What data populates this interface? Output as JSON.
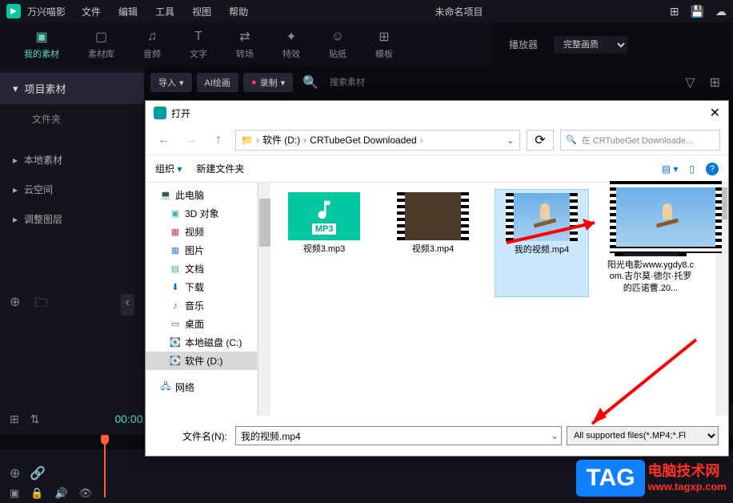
{
  "titlebar": {
    "app_name": "万兴喵影",
    "menu": [
      "文件",
      "编辑",
      "工具",
      "视图",
      "帮助"
    ],
    "project": "未命名项目"
  },
  "tools": [
    {
      "label": "我的素材",
      "icon": "▣"
    },
    {
      "label": "素材库",
      "icon": "▢"
    },
    {
      "label": "音频",
      "icon": "♫"
    },
    {
      "label": "文字",
      "icon": "T"
    },
    {
      "label": "转场",
      "icon": "⇄"
    },
    {
      "label": "特效",
      "icon": "✦"
    },
    {
      "label": "贴纸",
      "icon": "☺"
    },
    {
      "label": "模板",
      "icon": "⊞"
    }
  ],
  "sidebar": {
    "header": "项目素材",
    "sub": "文件夹",
    "items": [
      "本地素材",
      "云空间",
      "调整图层"
    ]
  },
  "content_header": {
    "import": "导入",
    "ai": "AI绘画",
    "record": "录制",
    "search_ph": "搜索素材"
  },
  "player": {
    "label": "播放器",
    "quality": "完整画质"
  },
  "timeline": {
    "time": "00:00"
  },
  "dialog": {
    "title": "打开",
    "breadcrumb": [
      "软件 (D:)",
      "CRTubeGet Downloaded"
    ],
    "search_ph": "在 CRTubeGet Downloade...",
    "toolbar": {
      "organize": "组织",
      "new_folder": "新建文件夹"
    },
    "tree": [
      {
        "label": "此电脑",
        "icon": "💻",
        "cls": ""
      },
      {
        "label": "3D 对象",
        "icon": "🧊",
        "cls": "sub"
      },
      {
        "label": "视频",
        "icon": "🎞",
        "cls": "sub"
      },
      {
        "label": "图片",
        "icon": "🖼",
        "cls": "sub"
      },
      {
        "label": "文档",
        "icon": "📄",
        "cls": "sub"
      },
      {
        "label": "下载",
        "icon": "⬇",
        "cls": "sub"
      },
      {
        "label": "音乐",
        "icon": "♪",
        "cls": "sub"
      },
      {
        "label": "桌面",
        "icon": "🖥",
        "cls": "sub"
      },
      {
        "label": "本地磁盘 (C:)",
        "icon": "💽",
        "cls": "sub"
      },
      {
        "label": "软件 (D:)",
        "icon": "💽",
        "cls": "sub sel"
      },
      {
        "label": "网络",
        "icon": "🌐",
        "cls": ""
      }
    ],
    "files": [
      {
        "name": "视频3.mp3",
        "type": "mp3"
      },
      {
        "name": "视频3.mp4",
        "type": "video"
      },
      {
        "name": "我的视频.mp4",
        "type": "sky",
        "selected": true
      },
      {
        "name": "阳光电影www.ygdy8.com.吉尔莫·德尔·托罗的匹诺曹.20...",
        "type": "dark"
      }
    ],
    "footer": {
      "label": "文件名(N):",
      "value": "我的视频.mp4",
      "filter": "All supported files(*.MP4;*.Fl"
    }
  },
  "tag": {
    "box": "TAG",
    "line1": "电脑技术网",
    "line2": "www.tagxp.com"
  }
}
